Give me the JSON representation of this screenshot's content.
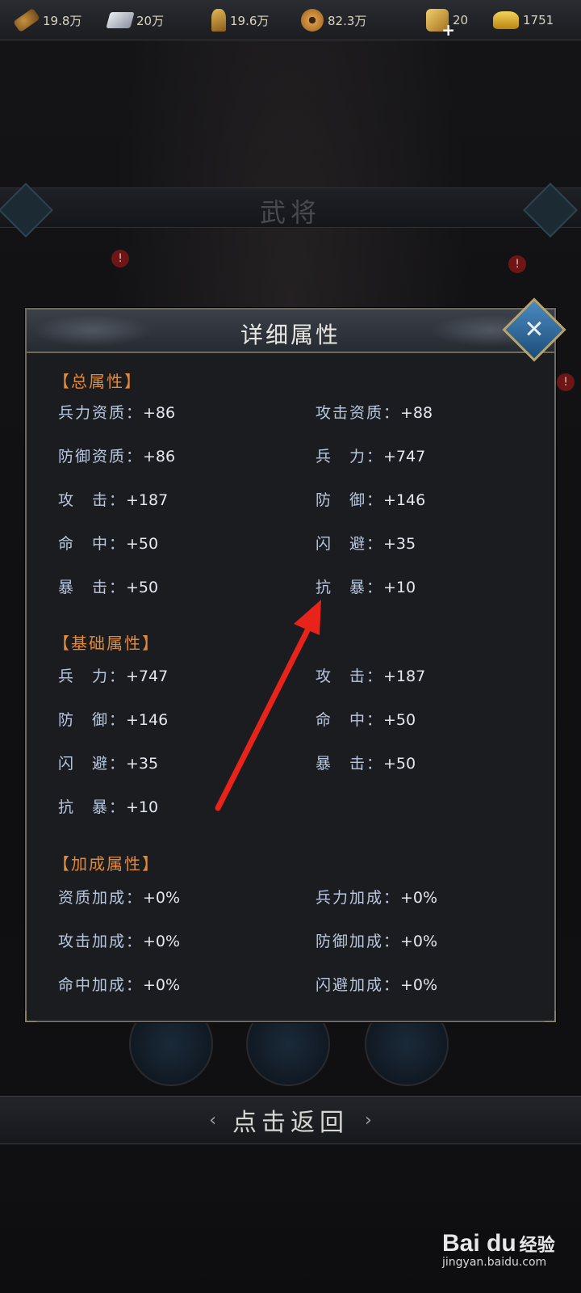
{
  "resources": {
    "wood": "19.8万",
    "iron": "20万",
    "grain": "19.6万",
    "coin": "82.3万",
    "token": "20",
    "gold": "1751"
  },
  "background": {
    "title": "武将",
    "alert": "!"
  },
  "modal": {
    "title": "详细属性",
    "sections": {
      "total": "【总属性】",
      "base": "【基础属性】",
      "bonus": "【加成属性】"
    },
    "total": [
      {
        "label": "兵力资质：",
        "value": "+86"
      },
      {
        "label": "攻击资质：",
        "value": "+88"
      },
      {
        "label": "防御资质：",
        "value": "+86"
      },
      {
        "label": "兵　力：",
        "value": "+747"
      },
      {
        "label": "攻　击：",
        "value": "+187"
      },
      {
        "label": "防　御：",
        "value": "+146"
      },
      {
        "label": "命　中：",
        "value": "+50"
      },
      {
        "label": "闪　避：",
        "value": "+35"
      },
      {
        "label": "暴　击：",
        "value": "+50"
      },
      {
        "label": "抗　暴：",
        "value": "+10"
      }
    ],
    "base": [
      {
        "label": "兵　力：",
        "value": "+747"
      },
      {
        "label": "攻　击：",
        "value": "+187"
      },
      {
        "label": "防　御：",
        "value": "+146"
      },
      {
        "label": "命　中：",
        "value": "+50"
      },
      {
        "label": "闪　避：",
        "value": "+35"
      },
      {
        "label": "暴　击：",
        "value": "+50"
      },
      {
        "label": "抗　暴：",
        "value": "+10"
      }
    ],
    "bonus": [
      {
        "label": "资质加成：",
        "value": "+0%"
      },
      {
        "label": "兵力加成：",
        "value": "+0%"
      },
      {
        "label": "攻击加成：",
        "value": "+0%"
      },
      {
        "label": "防御加成：",
        "value": "+0%"
      },
      {
        "label": "命中加成：",
        "value": "+0%"
      },
      {
        "label": "闪避加成：",
        "value": "+0%"
      }
    ]
  },
  "return_button": {
    "label": "点击返回",
    "left_arrow": "‹",
    "right_arrow": "›"
  },
  "watermark": {
    "brand": "Bai du",
    "jingyan": "经验",
    "url": "jingyan.baidu.com"
  },
  "colors": {
    "section_header": "#e08a3a",
    "stat_label": "#b9c7e0",
    "pointer_arrow": "#e8231a",
    "close_button": "#2f6fa5"
  }
}
